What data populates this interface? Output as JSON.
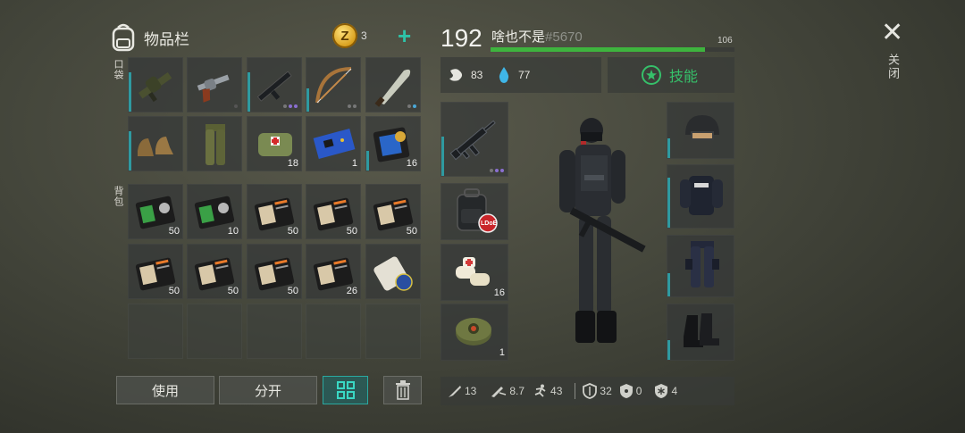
{
  "inventory": {
    "title": "物品栏",
    "coins": "3",
    "pocket_label": "口袋",
    "backpack_label": "背包"
  },
  "pocket_items": [
    {
      "name": "grenade-launcher",
      "qty": "",
      "dots": []
    },
    {
      "name": "revolver",
      "qty": "",
      "dots": [
        "#555"
      ]
    },
    {
      "name": "assault-rifle",
      "qty": "",
      "dots": [
        "#777",
        "#8a6fd0",
        "#8a6fd0"
      ]
    },
    {
      "name": "bow",
      "qty": "",
      "dots": [
        "#777",
        "#777"
      ]
    },
    {
      "name": "machete",
      "qty": "",
      "dots": [
        "#777",
        "#4aa8d8"
      ]
    },
    {
      "name": "boots",
      "qty": "",
      "dots": []
    },
    {
      "name": "camo-pants",
      "qty": "",
      "dots": []
    },
    {
      "name": "medkit-bag",
      "qty": "18",
      "dots": []
    },
    {
      "name": "circuit-board",
      "qty": "1",
      "dots": []
    },
    {
      "name": "police-badge",
      "qty": "16",
      "dots": []
    }
  ],
  "backpack_items": [
    {
      "name": "green-id-card",
      "qty": "50"
    },
    {
      "name": "green-id-card",
      "qty": "10"
    },
    {
      "name": "recipe-book",
      "qty": "50"
    },
    {
      "name": "recipe-book",
      "qty": "50"
    },
    {
      "name": "recipe-book",
      "qty": "50"
    },
    {
      "name": "recipe-book",
      "qty": "50"
    },
    {
      "name": "recipe-book",
      "qty": "50"
    },
    {
      "name": "recipe-book",
      "qty": "50"
    },
    {
      "name": "recipe-book",
      "qty": "26"
    },
    {
      "name": "police-map-scroll",
      "qty": ""
    },
    {
      "name": "empty",
      "qty": ""
    },
    {
      "name": "empty",
      "qty": ""
    },
    {
      "name": "empty",
      "qty": ""
    },
    {
      "name": "empty",
      "qty": ""
    },
    {
      "name": "empty",
      "qty": ""
    }
  ],
  "buttons": {
    "use": "使用",
    "split": "分开"
  },
  "player": {
    "level": "192",
    "name": "啥也不是",
    "id": "#5670",
    "xp_value": "106",
    "xp_progress": 0.88,
    "hunger": "83",
    "thirst": "77",
    "skills_label": "技能"
  },
  "equipment": {
    "weapon_dots": [
      "#777",
      "#8a6fd0",
      "#8a6fd0"
    ],
    "bandage_qty": "16",
    "trap_qty": "1",
    "backpack_badge": "LDoE"
  },
  "combat_stats": {
    "melee": "13",
    "ranged": "8.7",
    "speed": "43",
    "armor": "32",
    "radiation": "0",
    "cold": "4"
  },
  "close_label": "关闭",
  "colors": {
    "accent": "#2ec3a8",
    "xp_green": "#3eb43e",
    "slot_bar": "#2f9aa0"
  }
}
